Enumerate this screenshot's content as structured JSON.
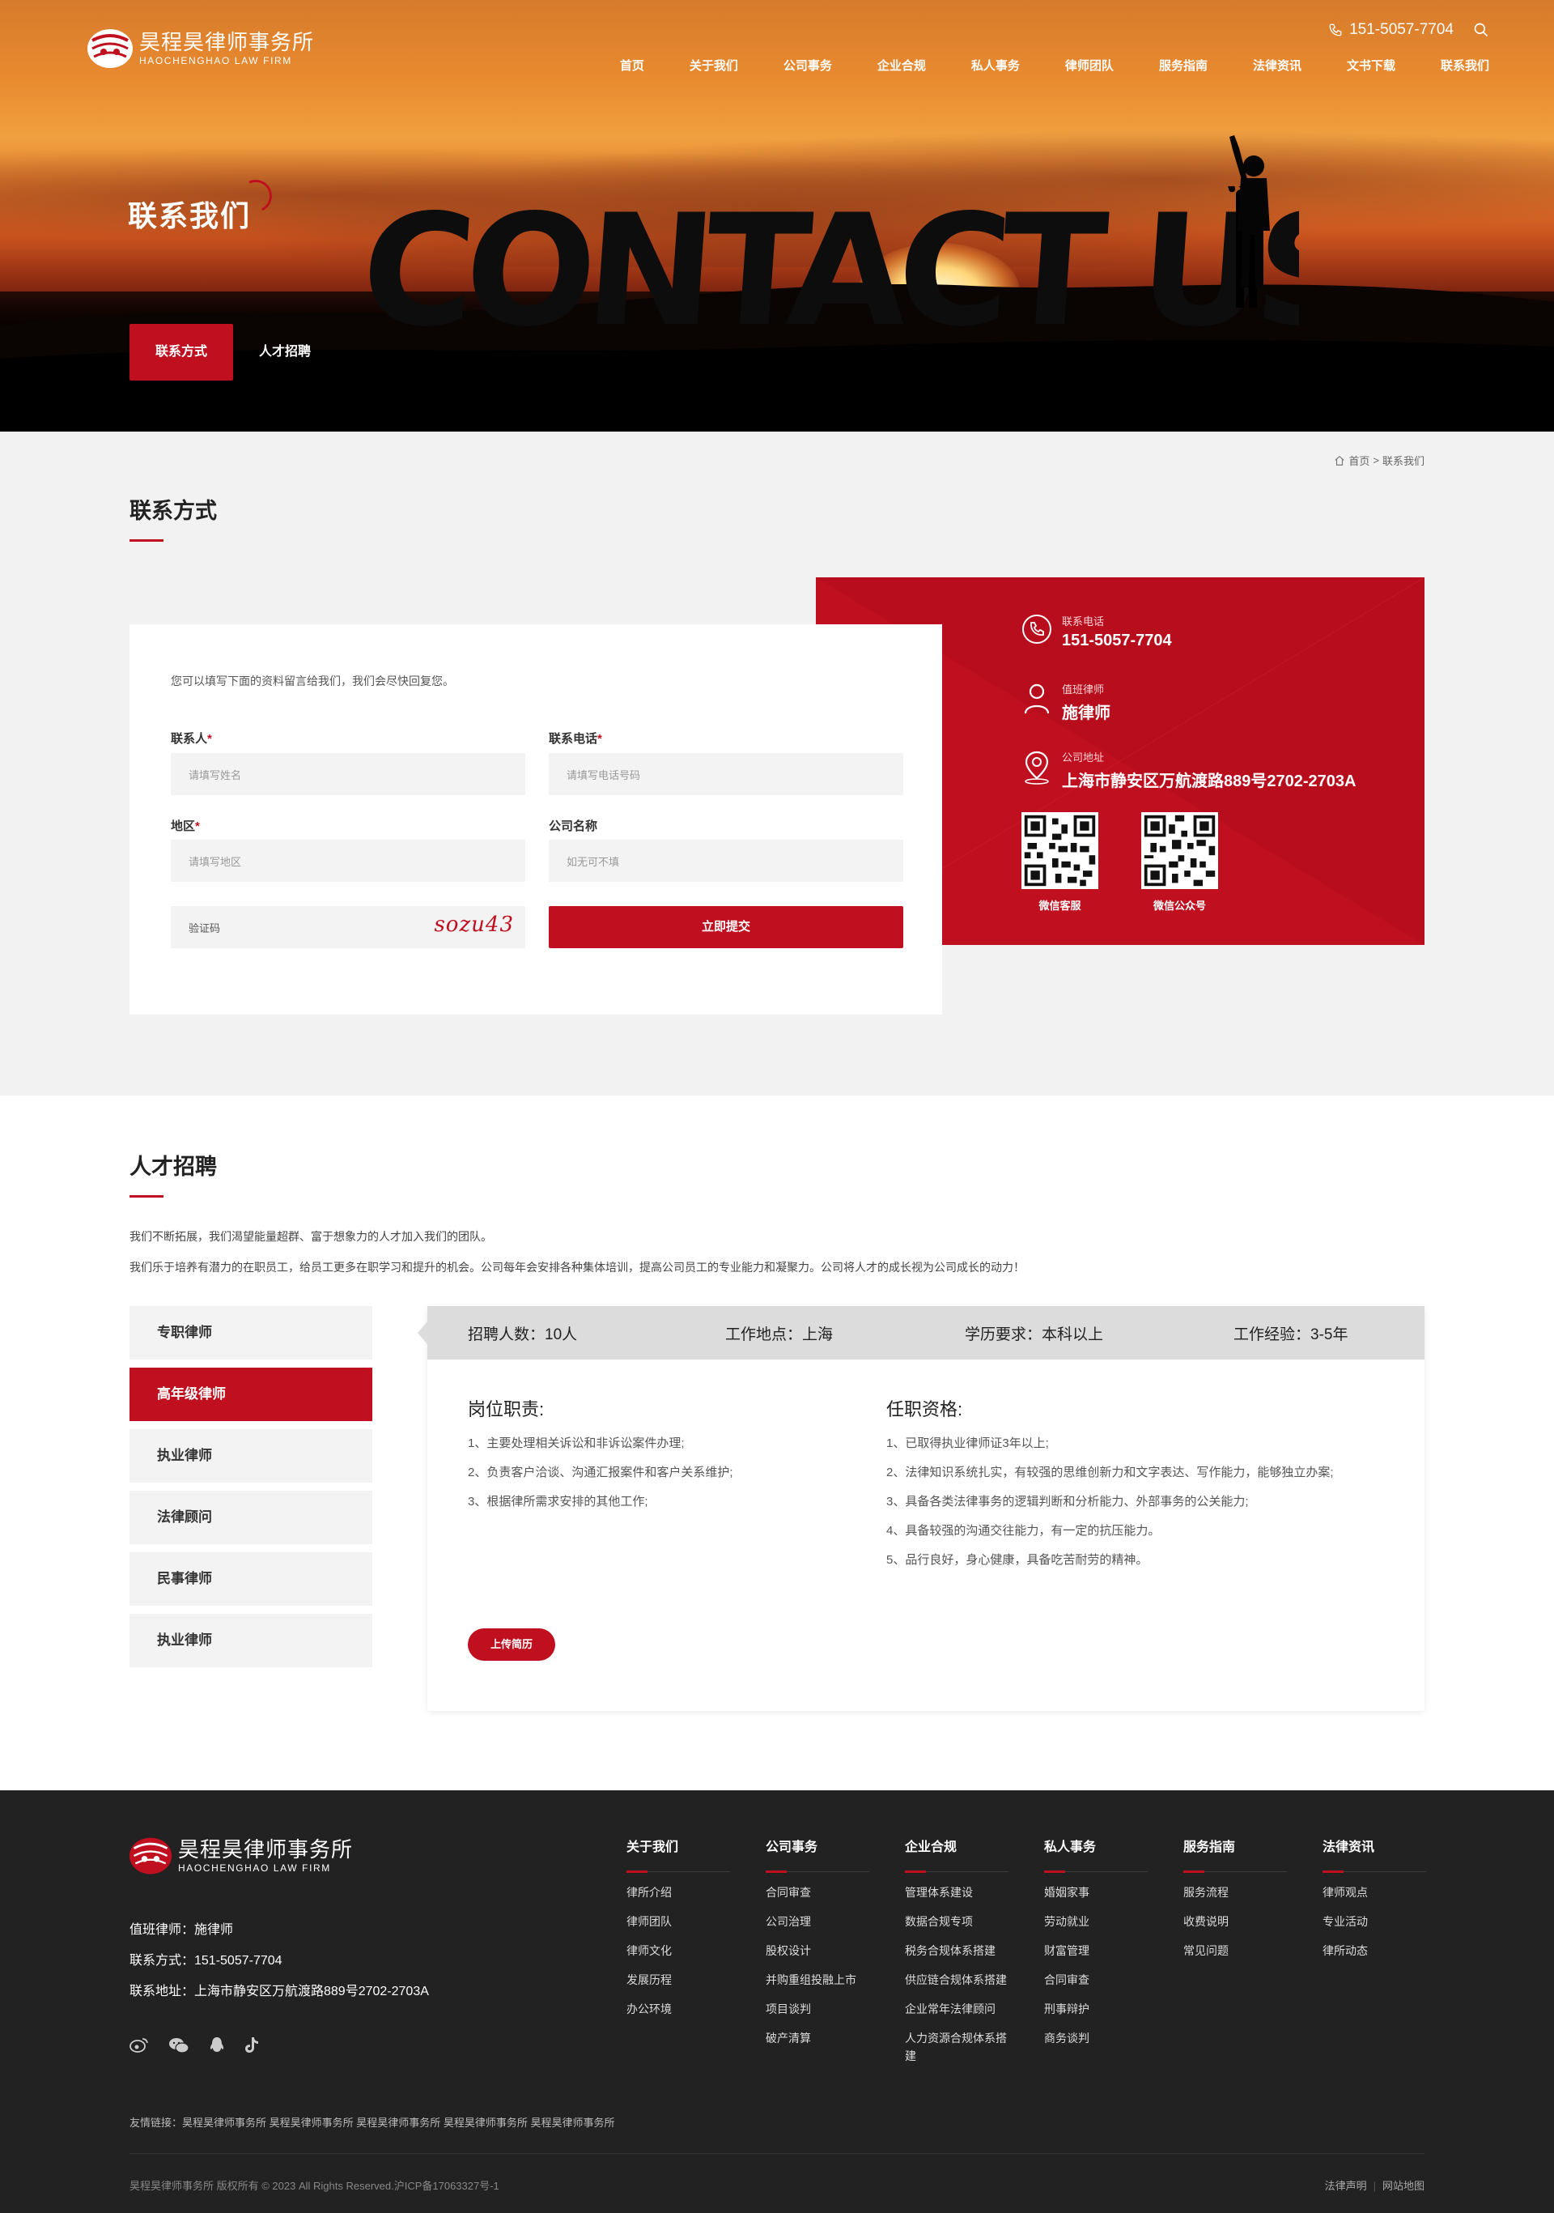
{
  "brand": {
    "name_cn": "昊程昊律师事务所",
    "name_en": "HAOCHENGHAO LAW FIRM"
  },
  "header": {
    "phone": "151-5057-7704",
    "nav": [
      "首页",
      "关于我们",
      "公司事务",
      "企业合规",
      "私人事务",
      "律师团队",
      "服务指南",
      "法律资讯",
      "文书下载",
      "联系我们"
    ]
  },
  "hero": {
    "title": "联系我们",
    "big_text": "CONTACT US",
    "tabs": [
      "联系方式",
      "人才招聘"
    ]
  },
  "breadcrumb": {
    "home": "首页",
    "sep": ">",
    "current": "联系我们"
  },
  "contact": {
    "title": "联系方式",
    "intro": "您可以填写下面的资料留言给我们，我们会尽快回复您。",
    "fields": {
      "name_label": "联系人",
      "name_placeholder": "请填写姓名",
      "phone_label": "联系电话",
      "phone_placeholder": "请填写电话号码",
      "region_label": "地区",
      "region_placeholder": "请填写地区",
      "company_label": "公司名称",
      "company_placeholder": "如无可不填",
      "captcha_placeholder": "验证码",
      "captcha_code": "sozu43",
      "required_mark": "*"
    },
    "submit_label": "立即提交",
    "info": {
      "phone_label": "联系电话",
      "phone_value": "151-5057-7704",
      "lawyer_label": "值班律师",
      "lawyer_value": "施律师",
      "address_label": "公司地址",
      "address_value": "上海市静安区万航渡路889号2702-2703A",
      "qr1_caption": "微信客服",
      "qr2_caption": "微信公众号"
    }
  },
  "recruit": {
    "title": "人才招聘",
    "intro1": "我们不断拓展，我们渴望能量超群、富于想象力的人才加入我们的团队。",
    "intro2": "我们乐于培养有潜力的在职员工，给员工更多在职学习和提升的机会。公司每年会安排各种集体培训，提高公司员工的专业能力和凝聚力。公司将人才的成长视为公司成长的动力！",
    "tabs": [
      "专职律师",
      "高年级律师",
      "执业律师",
      "法律顾问",
      "民事律师",
      "执业律师"
    ],
    "active_tab": 1,
    "job": {
      "headcount": "招聘人数：10人",
      "location": "工作地点：上海",
      "education": "学历要求：本科以上",
      "experience": "工作经验：3-5年",
      "duties_title": "岗位职责:",
      "duties": [
        "1、主要处理相关诉讼和非诉讼案件办理;",
        "2、负责客户洽谈、沟通汇报案件和客户关系维护;",
        "3、根据律所需求安排的其他工作;"
      ],
      "requirements_title": "任职资格:",
      "requirements": [
        "1、已取得执业律师证3年以上;",
        "2、法律知识系统扎实，有较强的思维创新力和文字表达、写作能力，能够独立办案;",
        "3、具备各类法律事务的逻辑判断和分析能力、外部事务的公关能力;",
        "4、具备较强的沟通交往能力，有一定的抗压能力。",
        "5、品行良好，身心健康，具备吃苦耐劳的精神。"
      ],
      "upload_label": "上传简历"
    }
  },
  "footer": {
    "lawyer": "值班律师：施律师",
    "contact": "联系方式：151-5057-7704",
    "address": "联系地址：上海市静安区万航渡路889号2702-2703A",
    "columns": [
      {
        "title": "关于我们",
        "items": [
          "律所介绍",
          "律师团队",
          "律师文化",
          "发展历程",
          "办公环境"
        ]
      },
      {
        "title": "公司事务",
        "items": [
          "合同审查",
          "公司治理",
          "股权设计",
          "并购重组投融上市",
          "项目谈判",
          "破产清算"
        ]
      },
      {
        "title": "企业合规",
        "items": [
          "管理体系建设",
          "数据合规专项",
          "税务合规体系搭建",
          "供应链合规体系搭建",
          "企业常年法律顾问",
          "人力资源合规体系搭建"
        ]
      },
      {
        "title": "私人事务",
        "items": [
          "婚姻家事",
          "劳动就业",
          "财富管理",
          "合同审查",
          "刑事辩护",
          "商务谈判"
        ]
      },
      {
        "title": "服务指南",
        "items": [
          "服务流程",
          "收费说明",
          "常见问题"
        ]
      },
      {
        "title": "法律资讯",
        "items": [
          "律师观点",
          "专业活动",
          "律所动态"
        ]
      }
    ],
    "friend_links": "友情链接：昊程昊律师事务所 昊程昊律师事务所 昊程昊律师事务所 昊程昊律师事务所 昊程昊律师事务所",
    "copyright": "昊程昊律师事务所 版权所有 © 2023 All Rights Reserved.沪ICP备17063327号-1",
    "legal_statement": "法律声明",
    "sitemap": "网站地图"
  }
}
